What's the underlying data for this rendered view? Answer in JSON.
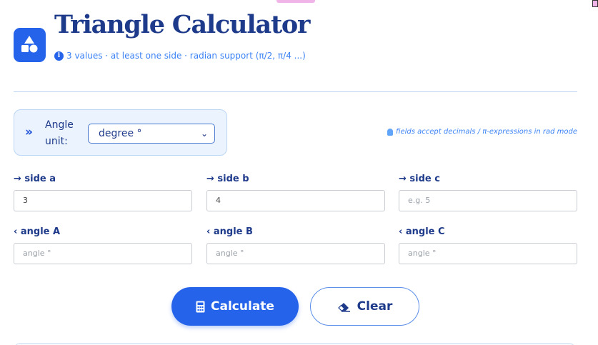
{
  "header": {
    "title": "Triangle Calculator",
    "subtitle": "3 values · at least one side · radian support (π/2, π/4 ...)",
    "info_icon": "i"
  },
  "angle_unit": {
    "label": "Angle unit:",
    "selected": "degree °"
  },
  "hint": "fields accept decimals / π-expressions in rad mode",
  "sides": [
    {
      "label": "side a",
      "value": "3",
      "placeholder": ""
    },
    {
      "label": "side b",
      "value": "4",
      "placeholder": ""
    },
    {
      "label": "side c",
      "value": "",
      "placeholder": "e.g. 5"
    }
  ],
  "angles": [
    {
      "label": "angle A",
      "value": "",
      "placeholder": "angle °"
    },
    {
      "label": "angle B",
      "value": "",
      "placeholder": "angle °"
    },
    {
      "label": "angle C",
      "value": "",
      "placeholder": "angle °"
    }
  ],
  "buttons": {
    "calculate": "Calculate",
    "clear": "Clear"
  },
  "colors": {
    "accent": "#2563eb",
    "title": "#1e3a8a",
    "subtle": "#3b82f6"
  }
}
